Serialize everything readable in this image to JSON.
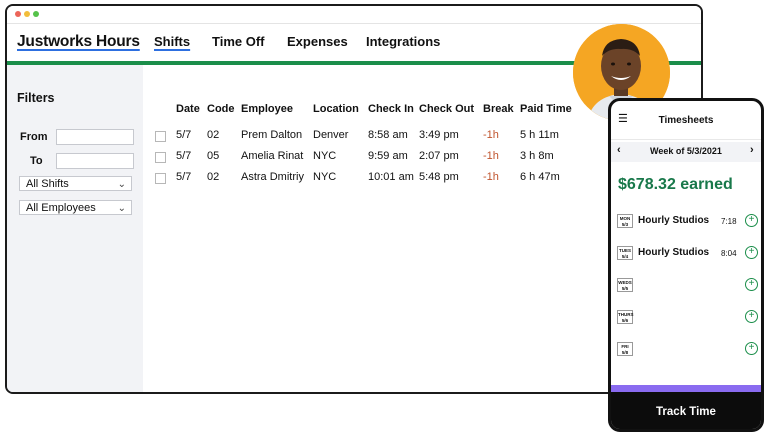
{
  "app": {
    "brand": "Justworks Hours",
    "nav": [
      "Shifts",
      "Time Off",
      "Expenses",
      "Integrations"
    ],
    "active_tab": "Shifts"
  },
  "filters": {
    "title": "Filters",
    "from_label": "From",
    "to_label": "To",
    "from_value": "",
    "to_value": "",
    "shifts_select": "All Shifts",
    "employees_select": "All Employees"
  },
  "table": {
    "headers": [
      "Date",
      "Code",
      "Employee",
      "Location",
      "Check In",
      "Check Out",
      "Break",
      "Paid Time"
    ],
    "rows": [
      [
        "5/7",
        "02",
        "Prem Dalton",
        "Denver",
        "8:58 am",
        "3:49 pm",
        "-1h",
        "5 h 11m"
      ],
      [
        "5/7",
        "05",
        "Amelia Rinat",
        "NYC",
        "9:59 am",
        "2:07 pm",
        "-1h",
        "3 h 8m"
      ],
      [
        "5/7",
        "02",
        "Astra Dmitriy",
        "NYC",
        "10:01 am",
        "5:48 pm",
        "-1h",
        "6 h 47m"
      ]
    ]
  },
  "phone": {
    "title": "Timesheets",
    "week": "Week of 5/3/2021",
    "earned": "$678.32 earned",
    "days": [
      {
        "badge_day": "MON",
        "badge_date": "5/3",
        "client": "Hourly Studios",
        "hours": "7:18"
      },
      {
        "badge_day": "TUES",
        "badge_date": "5/4",
        "client": "Hourly Studios",
        "hours": "8:04"
      },
      {
        "badge_day": "WEDS",
        "badge_date": "5/5",
        "client": "",
        "hours": ""
      },
      {
        "badge_day": "THURS",
        "badge_date": "5/6",
        "client": "",
        "hours": ""
      },
      {
        "badge_day": "FRI",
        "badge_date": "5/8",
        "client": "",
        "hours": ""
      }
    ],
    "cta": "Track Time"
  },
  "colors": {
    "brand_green": "#1b8e4a",
    "earned_green": "#18784a",
    "accent_blue": "#2d6fe0",
    "break_orange": "#c0542e",
    "purple": "#8a6bf0",
    "avatar_bg": "#f5a623"
  },
  "icons": [
    "menu-icon",
    "chevron-left-icon",
    "chevron-right-icon",
    "chevron-down-icon",
    "plus-circle-icon"
  ]
}
